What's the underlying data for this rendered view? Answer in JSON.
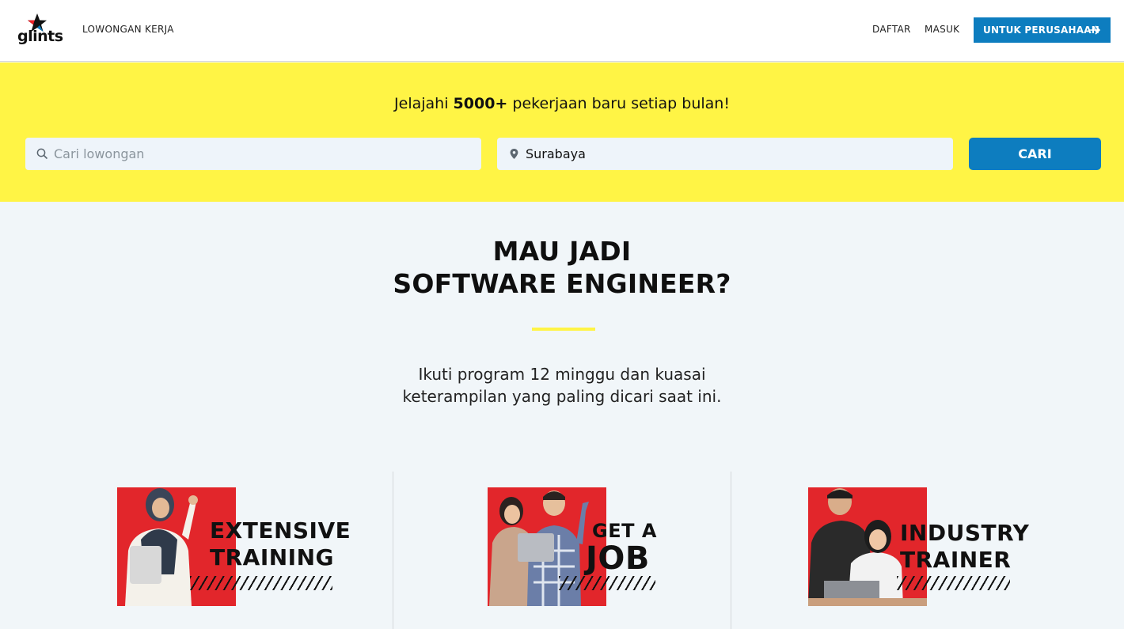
{
  "header": {
    "logo_text": "glints",
    "nav_jobs": "LOWONGAN KERJA",
    "register": "DAFTAR",
    "login": "MASUK",
    "for_companies": "UNTUK PERUSAHAAN"
  },
  "search": {
    "headline_pre": "Jelajahi ",
    "headline_bold": "5000+",
    "headline_post": " pekerjaan baru setiap bulan!",
    "job_placeholder": "Cari lowongan",
    "location_value": "Surabaya",
    "button": "CARI"
  },
  "hero": {
    "title_line1": "MAU JADI",
    "title_line2": "SOFTWARE ENGINEER?",
    "subtitle_line1": "Ikuti program 12 minggu dan kuasai",
    "subtitle_line2": "keterampilan yang paling dicari saat ini."
  },
  "features": [
    {
      "line1": "EXTENSIVE",
      "line2": "TRAINING"
    },
    {
      "line1": "GET A",
      "line2": "JOB"
    },
    {
      "line1": "INDUSTRY",
      "line2": "TRAINER"
    }
  ],
  "colors": {
    "brand_blue": "#0d7dbf",
    "highlight_yellow": "#fff445",
    "photo_red": "#e2262b"
  }
}
